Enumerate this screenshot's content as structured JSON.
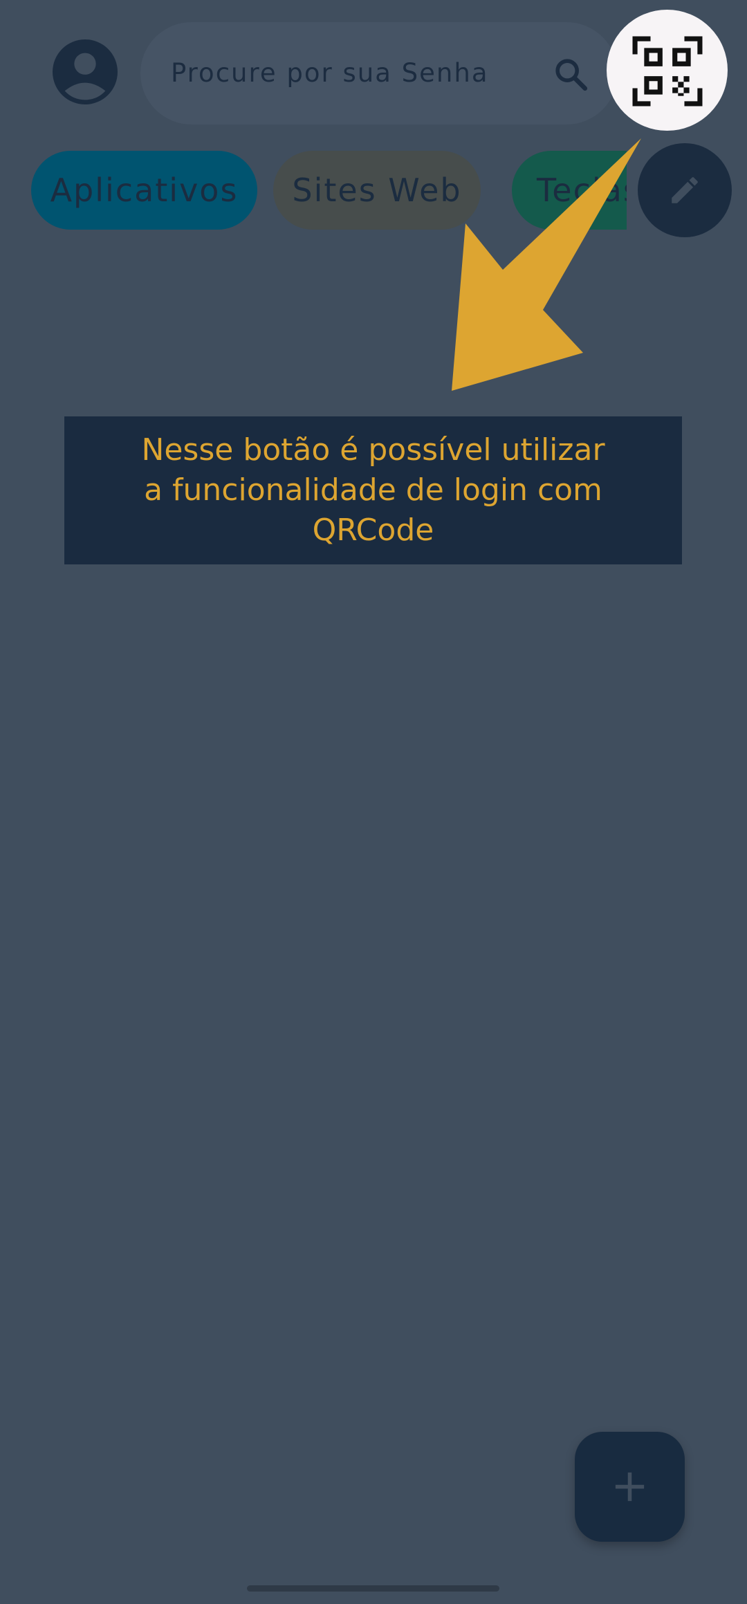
{
  "search": {
    "placeholder": "Procure por sua Senha"
  },
  "tabs": [
    {
      "label": "Aplicativos",
      "color": "#005470"
    },
    {
      "label": "Sites Web",
      "color": "#474d4c"
    },
    {
      "label": "Teclas",
      "color": "#145a4c"
    }
  ],
  "tooltip": {
    "text": "Nesse botão é possível utilizar a funcionalidade de login com QRCode"
  },
  "colors": {
    "background": "#404e5e",
    "accent": "#dda531",
    "dark": "#1b2c40"
  },
  "icons": {
    "avatar": "account-circle-icon",
    "search": "search-icon",
    "qr": "qr-code-scan-icon",
    "edit": "pencil-icon",
    "add": "plus-icon"
  }
}
